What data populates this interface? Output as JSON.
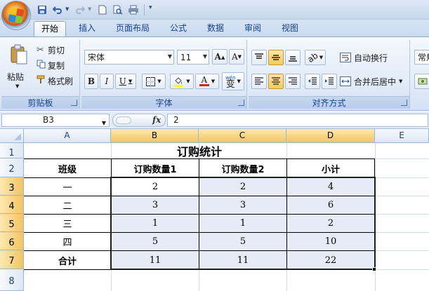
{
  "quick_access": {
    "items": [
      "save-icon",
      "undo-icon",
      "redo-icon",
      "new-icon",
      "print-preview-icon",
      "print-icon",
      "customize-icon"
    ]
  },
  "tabs": [
    {
      "label": "开始",
      "active": true
    },
    {
      "label": "插入",
      "active": false
    },
    {
      "label": "页面布局",
      "active": false
    },
    {
      "label": "公式",
      "active": false
    },
    {
      "label": "数据",
      "active": false
    },
    {
      "label": "审阅",
      "active": false
    },
    {
      "label": "视图",
      "active": false
    }
  ],
  "ribbon": {
    "clipboard": {
      "paste_label": "粘贴",
      "cut_label": "剪切",
      "copy_label": "复制",
      "format_painter_label": "格式刷",
      "group_label": "剪贴板"
    },
    "font": {
      "font_name": "宋体",
      "font_size": "11",
      "grow_label": "A",
      "shrink_label": "A",
      "bold_label": "B",
      "italic_label": "I",
      "underline_label": "U",
      "font_color_label": "A",
      "phonetic_label": "变",
      "phonetic_top": "wén",
      "group_label": "字体"
    },
    "alignment": {
      "wrap_label": "自动换行",
      "merge_label": "合并后居中",
      "group_label": "对齐方式"
    },
    "number": {
      "format_label": "常规"
    }
  },
  "formula_bar": {
    "cell_ref": "B3",
    "fx_label": "fx",
    "value": "2"
  },
  "sheet": {
    "columns": [
      "A",
      "B",
      "C",
      "D",
      "E"
    ],
    "rows": [
      "1",
      "2",
      "3",
      "4",
      "5",
      "6",
      "7",
      "8"
    ],
    "title": "订购统计",
    "headers": [
      "班级",
      "订购数量1",
      "订购数量2",
      "小计"
    ],
    "data": [
      [
        "一",
        "2",
        "2",
        "4"
      ],
      [
        "二",
        "3",
        "3",
        "6"
      ],
      [
        "三",
        "1",
        "1",
        "2"
      ],
      [
        "四",
        "5",
        "5",
        "10"
      ],
      [
        "合计",
        "11",
        "11",
        "22"
      ]
    ]
  },
  "colors": {
    "selection_fill": "#e6ebf6",
    "header_highlight": "#f4c35e",
    "ribbon_text": "#15428b"
  }
}
